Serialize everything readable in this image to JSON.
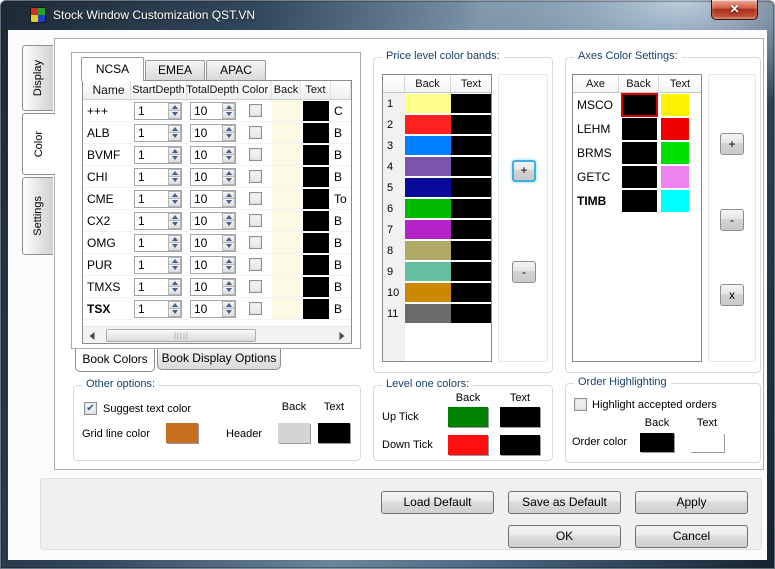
{
  "window": {
    "title": "Stock Window Customization QST.VN"
  },
  "icons": {
    "close": "✕",
    "check": "✔"
  },
  "side_tabs": {
    "display": "Display",
    "color": "Color",
    "settings": "Settings"
  },
  "book": {
    "region_tabs": [
      "NCSA",
      "EMEA",
      "APAC"
    ],
    "headers": {
      "name": "Name",
      "start": "StartDepth",
      "total": "TotalDepth",
      "color": "Color",
      "back": "Back",
      "text": "Text"
    },
    "back_cell_color": "#FBFAE4",
    "text_cell_color": "#000000",
    "rows": [
      {
        "name": "+++",
        "start": "1",
        "total": "10",
        "back": "#FBFAE4",
        "text": "#000000",
        "extra": "C"
      },
      {
        "name": "ALB",
        "start": "1",
        "total": "10",
        "back": "#FBFAE4",
        "text": "#000000",
        "extra": "B"
      },
      {
        "name": "BVMF",
        "start": "1",
        "total": "10",
        "back": "#FBFAE4",
        "text": "#000000",
        "extra": "B"
      },
      {
        "name": "CHI",
        "start": "1",
        "total": "10",
        "back": "#FBFAE4",
        "text": "#000000",
        "extra": "B"
      },
      {
        "name": "CME",
        "start": "1",
        "total": "10",
        "back": "#FBFAE4",
        "text": "#000000",
        "extra": "To"
      },
      {
        "name": "CX2",
        "start": "1",
        "total": "10",
        "back": "#FBFAE4",
        "text": "#000000",
        "extra": "B"
      },
      {
        "name": "OMG",
        "start": "1",
        "total": "10",
        "back": "#FBFAE4",
        "text": "#000000",
        "extra": "B"
      },
      {
        "name": "PUR",
        "start": "1",
        "total": "10",
        "back": "#FBFAE4",
        "text": "#000000",
        "extra": "B"
      },
      {
        "name": "TMXS",
        "start": "1",
        "total": "10",
        "back": "#FBFAE4",
        "text": "#000000",
        "extra": "B"
      },
      {
        "name": "TSX",
        "start": "1",
        "total": "10",
        "back": "#FBFAE4",
        "text": "#000000",
        "extra": "B"
      }
    ],
    "bottom_tabs": [
      "Book Colors",
      "Book Display Options"
    ]
  },
  "bands": {
    "legend": "Price level color bands:",
    "headers": {
      "back": "Back",
      "text": "Text"
    },
    "add": "+",
    "remove": "-",
    "rows": [
      {
        "num": "1",
        "back": "#FFFF8C",
        "text": "#000000"
      },
      {
        "num": "2",
        "back": "#FF2020",
        "text": "#000000"
      },
      {
        "num": "3",
        "back": "#0080FF",
        "text": "#000000"
      },
      {
        "num": "4",
        "back": "#7B55AB",
        "text": "#000000"
      },
      {
        "num": "5",
        "back": "#0A0A9B",
        "text": "#000000"
      },
      {
        "num": "6",
        "back": "#00BB00",
        "text": "#000000"
      },
      {
        "num": "7",
        "back": "#B422C8",
        "text": "#000000"
      },
      {
        "num": "8",
        "back": "#B0AA66",
        "text": "#000000"
      },
      {
        "num": "9",
        "back": "#66BFA0",
        "text": "#000000"
      },
      {
        "num": "10",
        "back": "#CC8800",
        "text": "#000000"
      },
      {
        "num": "11",
        "back": "#6B6B6B",
        "text": "#000000"
      }
    ]
  },
  "axes": {
    "legend": "Axes Color Settings:",
    "headers": {
      "axe": "Axe",
      "back": "Back",
      "text": "Text"
    },
    "add": "+",
    "remove": "-",
    "delete": "x",
    "rows": [
      {
        "axe": "MSCO",
        "back": "#000000",
        "text": "#FFF200"
      },
      {
        "axe": "LEHM",
        "back": "#000000",
        "text": "#EE0000"
      },
      {
        "axe": "BRMS",
        "back": "#000000",
        "text": "#00E000"
      },
      {
        "axe": "GETC",
        "back": "#000000",
        "text": "#EE82EE"
      },
      {
        "axe": "TIMB",
        "back": "#000000",
        "text": "#00FFFF"
      }
    ]
  },
  "other": {
    "legend": "Other options:",
    "suggest_label": "Suggest  text color",
    "grid_label": "Grid line color",
    "grid_color": "#C8701F",
    "header_label": "Header",
    "back": "Back",
    "text": "Text",
    "header_back": "#D4D4D4",
    "header_text": "#000000"
  },
  "level_one": {
    "legend": "Level one colors:",
    "back": "Back",
    "text": "Text",
    "up_label": "Up Tick",
    "down_label": "Down Tick",
    "up_back": "#008000",
    "up_text": "#000000",
    "down_back": "#FF1010",
    "down_text": "#000000"
  },
  "order": {
    "legend": "Order Highlighting",
    "highlight_label": "Highlight accepted orders",
    "back": "Back",
    "text": "Text",
    "color_label": "Order color",
    "order_back": "#000000",
    "order_text": "#FFFFFF"
  },
  "buttons": {
    "load": "Load Default",
    "save": "Save as Default",
    "apply": "Apply",
    "ok": "OK",
    "cancel": "Cancel"
  }
}
